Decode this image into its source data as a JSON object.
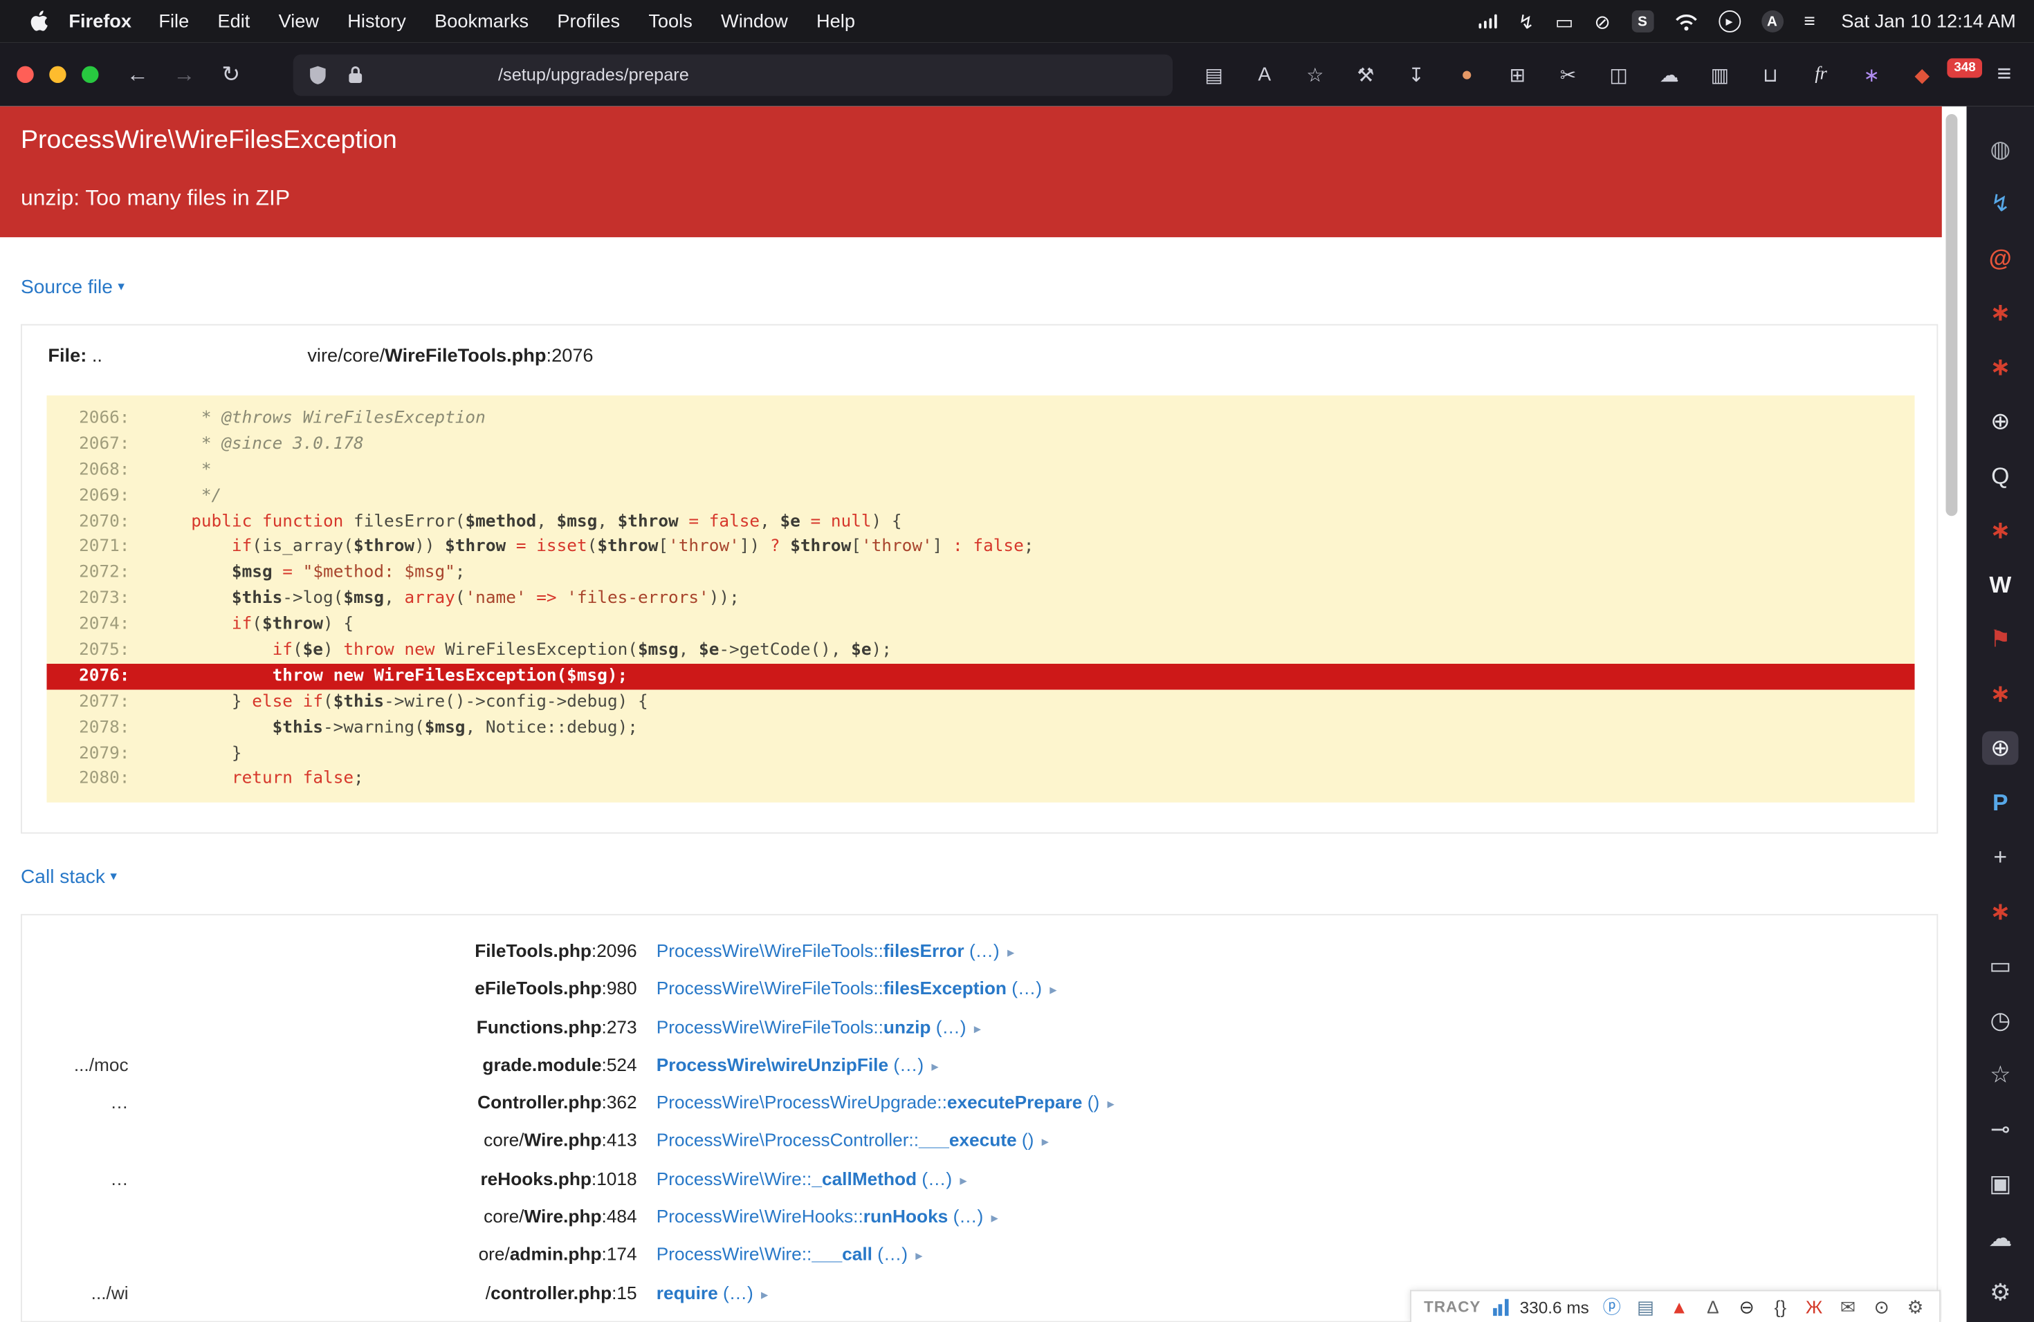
{
  "menubar": {
    "app_name": "Firefox",
    "items": [
      "File",
      "Edit",
      "View",
      "History",
      "Bookmarks",
      "Profiles",
      "Tools",
      "Window",
      "Help"
    ],
    "status_icons": [
      {
        "name": "cellular-signal-icon",
        "type": "bars"
      },
      {
        "name": "power-flash-icon",
        "glyph": "↯"
      },
      {
        "name": "display-mirroring-icon",
        "glyph": "▭"
      },
      {
        "name": "mute-icon",
        "glyph": "⊘"
      },
      {
        "name": "app-badge-s-icon",
        "glyph": "S",
        "chip": "square"
      },
      {
        "name": "wifi-icon",
        "type": "wifi"
      },
      {
        "name": "play-status-icon",
        "glyph": "▶",
        "chip": "ring"
      },
      {
        "name": "app-badge-a-icon",
        "glyph": "A",
        "chip": "circle"
      },
      {
        "name": "menu-list-icon",
        "glyph": "≡"
      }
    ],
    "clock": "Sat Jan 10 12:14 AM"
  },
  "toolbar": {
    "url": "/setup/upgrades/prepare",
    "extension_badge": "348",
    "left_icons": [
      {
        "name": "back-icon",
        "glyph": "←"
      },
      {
        "name": "forward-icon",
        "glyph": "→",
        "dim": true
      },
      {
        "name": "reload-icon",
        "glyph": "↻"
      }
    ],
    "right_icons": [
      {
        "name": "reader-view-icon",
        "glyph": "▤"
      },
      {
        "name": "translate-icon",
        "glyph": "A"
      },
      {
        "name": "bookmark-star-icon",
        "glyph": "☆"
      },
      {
        "name": "tools-wrench-icon",
        "glyph": "⚒"
      },
      {
        "name": "downloads-icon",
        "glyph": "↧"
      },
      {
        "name": "account-avatar-icon",
        "glyph": "●",
        "color": "#e59866"
      },
      {
        "name": "extensions-puzzle-icon",
        "glyph": "⊞"
      },
      {
        "name": "screenshot-icon",
        "glyph": "✂"
      },
      {
        "name": "sidebar-toggle-icon",
        "glyph": "◫"
      },
      {
        "name": "cloud-icon",
        "glyph": "☁"
      },
      {
        "name": "pocket-icon",
        "glyph": "▥"
      },
      {
        "name": "library-icon",
        "glyph": "⊔"
      },
      {
        "name": "fr-extension-icon",
        "glyph": "fr",
        "chip": true
      },
      {
        "name": "extension-flower-icon",
        "glyph": "∗",
        "color": "#b08cf0"
      },
      {
        "name": "adblock-shield-icon",
        "glyph": "◆",
        "color": "#e0543a"
      }
    ],
    "hamburger_glyph": "≡"
  },
  "page": {
    "error_title": "ProcessWire\\WireFilesException",
    "error_message": "unzip: Too many files in ZIP",
    "source_toggle": "Source file",
    "callstack_toggle": "Call stack",
    "file_label": "File:",
    "file_dots": "..",
    "file_dir": "vire/core/",
    "file_name": "WireFileTools.php",
    "file_line": ":2076",
    "caret_down": "▾",
    "link_arrow": "▸",
    "accent_red": "#cd1818",
    "link_blue": "#2878c8",
    "code_bg": "#fdf5ce"
  },
  "source_code": [
    {
      "no": "2066",
      "t": [
        [
          "cm",
          "     * @throws WireFilesException"
        ]
      ]
    },
    {
      "no": "2067",
      "t": [
        [
          "cm",
          "     * @since 3.0.178"
        ]
      ]
    },
    {
      "no": "2068",
      "t": [
        [
          "cm",
          "     *"
        ]
      ]
    },
    {
      "no": "2069",
      "t": [
        [
          "cm",
          "     */"
        ]
      ]
    },
    {
      "no": "2070",
      "t": [
        [
          "pl",
          "    "
        ],
        [
          "kw",
          "public function"
        ],
        [
          "pl",
          " filesError("
        ],
        [
          "vr",
          "$method"
        ],
        [
          "pl",
          ", "
        ],
        [
          "vr",
          "$msg"
        ],
        [
          "pl",
          ", "
        ],
        [
          "vr",
          "$throw"
        ],
        [
          "pl",
          " "
        ],
        [
          "kw",
          "="
        ],
        [
          "pl",
          " "
        ],
        [
          "kw",
          "false"
        ],
        [
          "pl",
          ", "
        ],
        [
          "vr",
          "$e"
        ],
        [
          "pl",
          " "
        ],
        [
          "kw",
          "="
        ],
        [
          "pl",
          " "
        ],
        [
          "kw",
          "null"
        ],
        [
          "pl",
          ") {"
        ]
      ]
    },
    {
      "no": "2071",
      "t": [
        [
          "pl",
          "        "
        ],
        [
          "kw",
          "if"
        ],
        [
          "pl",
          "(is_array("
        ],
        [
          "vr",
          "$throw"
        ],
        [
          "pl",
          ")) "
        ],
        [
          "vr",
          "$throw"
        ],
        [
          "pl",
          " "
        ],
        [
          "kw",
          "="
        ],
        [
          "pl",
          " "
        ],
        [
          "kw",
          "isset"
        ],
        [
          "pl",
          "("
        ],
        [
          "vr",
          "$throw"
        ],
        [
          "pl",
          "["
        ],
        [
          "st",
          "'throw'"
        ],
        [
          "pl",
          "]) "
        ],
        [
          "kw",
          "?"
        ],
        [
          "pl",
          " "
        ],
        [
          "vr",
          "$throw"
        ],
        [
          "pl",
          "["
        ],
        [
          "st",
          "'throw'"
        ],
        [
          "pl",
          "] "
        ],
        [
          "kw",
          ":"
        ],
        [
          "pl",
          " "
        ],
        [
          "kw",
          "false"
        ],
        [
          "pl",
          ";"
        ]
      ]
    },
    {
      "no": "2072",
      "t": [
        [
          "pl",
          "        "
        ],
        [
          "vr",
          "$msg"
        ],
        [
          "pl",
          " "
        ],
        [
          "kw",
          "="
        ],
        [
          "pl",
          " "
        ],
        [
          "st",
          "\"$method: $msg\""
        ],
        [
          "pl",
          ";"
        ]
      ]
    },
    {
      "no": "2073",
      "t": [
        [
          "pl",
          "        "
        ],
        [
          "vr",
          "$this"
        ],
        [
          "pl",
          "->log("
        ],
        [
          "vr",
          "$msg"
        ],
        [
          "pl",
          ", "
        ],
        [
          "kw",
          "array"
        ],
        [
          "pl",
          "("
        ],
        [
          "st",
          "'name'"
        ],
        [
          "pl",
          " "
        ],
        [
          "kw",
          "=>"
        ],
        [
          "pl",
          " "
        ],
        [
          "st",
          "'files-errors'"
        ],
        [
          "pl",
          "));"
        ]
      ]
    },
    {
      "no": "2074",
      "t": [
        [
          "pl",
          "        "
        ],
        [
          "kw",
          "if"
        ],
        [
          "pl",
          "("
        ],
        [
          "vr",
          "$throw"
        ],
        [
          "pl",
          ") {"
        ]
      ]
    },
    {
      "no": "2075",
      "t": [
        [
          "pl",
          "            "
        ],
        [
          "kw",
          "if"
        ],
        [
          "pl",
          "("
        ],
        [
          "vr",
          "$e"
        ],
        [
          "pl",
          ") "
        ],
        [
          "kw",
          "throw new"
        ],
        [
          "pl",
          " WireFilesException("
        ],
        [
          "vr",
          "$msg"
        ],
        [
          "pl",
          ", "
        ],
        [
          "vr",
          "$e"
        ],
        [
          "pl",
          "->getCode(), "
        ],
        [
          "vr",
          "$e"
        ],
        [
          "pl",
          ");"
        ]
      ]
    },
    {
      "no": "2076",
      "hl": true,
      "t": [
        [
          "pl",
          "            throw new WireFilesException($msg);"
        ]
      ]
    },
    {
      "no": "2077",
      "t": [
        [
          "pl",
          "        } "
        ],
        [
          "kw",
          "else if"
        ],
        [
          "pl",
          "("
        ],
        [
          "vr",
          "$this"
        ],
        [
          "pl",
          "->wire()->config->debug) {"
        ]
      ]
    },
    {
      "no": "2078",
      "t": [
        [
          "pl",
          "            "
        ],
        [
          "vr",
          "$this"
        ],
        [
          "pl",
          "->warning("
        ],
        [
          "vr",
          "$msg"
        ],
        [
          "pl",
          ", Notice::debug);"
        ]
      ]
    },
    {
      "no": "2079",
      "t": [
        [
          "pl",
          "        }"
        ]
      ]
    },
    {
      "no": "2080",
      "t": [
        [
          "pl",
          "        "
        ],
        [
          "kw",
          "return"
        ],
        [
          "pl",
          " "
        ],
        [
          "kw",
          "false"
        ],
        [
          "pl",
          ";"
        ]
      ]
    }
  ],
  "callstack": [
    {
      "left": "",
      "pre": "",
      "file": "FileTools.php",
      "line": ":2096",
      "ns": "ProcessWire\\WireFileTools::",
      "fn": "filesError",
      "args": " (…)"
    },
    {
      "left": "",
      "pre": "",
      "file": "eFileTools.php",
      "line": ":980",
      "ns": "ProcessWire\\WireFileTools::",
      "fn": "filesException",
      "args": " (…)"
    },
    {
      "left": "",
      "pre": "",
      "file": "Functions.php",
      "line": ":273",
      "ns": "ProcessWire\\WireFileTools::",
      "fn": "unzip",
      "args": " (…)"
    },
    {
      "left": ".../moc",
      "pre": "",
      "file": "grade.module",
      "line": ":524",
      "ns": "",
      "fn": "ProcessWire\\wireUnzipFile",
      "args": " (…)"
    },
    {
      "left": "…",
      "pre": "",
      "file": "Controller.php",
      "line": ":362",
      "ns": "ProcessWire\\ProcessWireUpgrade::",
      "fn": "executePrepare",
      "args": " ()"
    },
    {
      "left": "",
      "pre": "core/",
      "file": "Wire.php",
      "line": ":413",
      "ns": "ProcessWire\\ProcessController::",
      "fn": "___execute",
      "args": " ()"
    },
    {
      "left": "…",
      "pre": "",
      "file": "reHooks.php",
      "line": ":1018",
      "ns": "ProcessWire\\Wire::",
      "fn": "_callMethod",
      "args": " (…)"
    },
    {
      "left": "",
      "pre": "core/",
      "file": "Wire.php",
      "line": ":484",
      "ns": "ProcessWire\\WireHooks::",
      "fn": "runHooks",
      "args": " (…)"
    },
    {
      "left": "",
      "pre": "ore/",
      "file": "admin.php",
      "line": ":174",
      "ns": "ProcessWire\\Wire::",
      "fn": "___call",
      "args": " (…)"
    },
    {
      "left": ".../wi",
      "pre": "/",
      "file": "controller.php",
      "line": ":15",
      "ns": "",
      "fn": "require",
      "args": " (…)"
    }
  ],
  "tracy": {
    "logo": "TRACY",
    "time": "330.6 ms",
    "icons": [
      {
        "name": "tracy-info-icon",
        "glyph": "ⓟ",
        "color": "#3a85d0"
      },
      {
        "name": "tracy-dumps-icon",
        "glyph": "▤",
        "color": "#5a7d9a"
      },
      {
        "name": "tracy-rocket-icon",
        "glyph": "▲",
        "color": "#e23c2e"
      },
      {
        "name": "tracy-bell-icon",
        "glyph": "∆",
        "color": "#555555"
      },
      {
        "name": "tracy-ban-icon",
        "glyph": "⊖",
        "color": "#333333"
      },
      {
        "name": "tracy-braces-icon",
        "glyph": "{}",
        "color": "#444444"
      },
      {
        "name": "tracy-bug-icon",
        "glyph": "Ж",
        "color": "#d43a2a"
      },
      {
        "name": "tracy-mail-icon",
        "glyph": "✉",
        "color": "#555555"
      },
      {
        "name": "tracy-power-icon",
        "glyph": "⊙",
        "color": "#444444"
      },
      {
        "name": "tracy-gear-icon",
        "glyph": "⚙",
        "color": "#555555"
      }
    ]
  },
  "sidebar_icons": [
    {
      "name": "tab-favicon-sphere",
      "glyph": "◍",
      "color": "#a9adb4"
    },
    {
      "name": "tab-favicon-flash",
      "glyph": "↯",
      "color": "#57a8e8"
    },
    {
      "name": "tab-favicon-swirl",
      "glyph": "@",
      "color": "#e8553a",
      "bold": true
    },
    {
      "name": "tab-favicon-asterisk-1",
      "glyph": "∗",
      "color": "#d6402e",
      "bold": true
    },
    {
      "name": "tab-favicon-asterisk-2",
      "glyph": "∗",
      "color": "#d6402e",
      "bold": true
    },
    {
      "name": "tab-favicon-globe-1",
      "glyph": "⊕",
      "color": "#e4e6ea"
    },
    {
      "name": "tab-favicon-circle",
      "glyph": "Q",
      "color": "#dfe2e6"
    },
    {
      "name": "tab-favicon-asterisk-3",
      "glyph": "∗",
      "color": "#d6402e",
      "bold": true
    },
    {
      "name": "tab-favicon-wikipedia",
      "glyph": "W",
      "color": "#f2f2f4",
      "bold": true
    },
    {
      "name": "tab-favicon-flag",
      "glyph": "⚑",
      "color": "#cc3b34"
    },
    {
      "name": "tab-favicon-asterisk-4",
      "glyph": "∗",
      "color": "#d6402e",
      "bold": true
    },
    {
      "name": "tab-favicon-globe-active",
      "glyph": "⊕",
      "color": "#eef0f4",
      "active": true
    },
    {
      "name": "tab-favicon-processwire",
      "glyph": "P",
      "color": "#57a8e8",
      "bold": true
    },
    {
      "name": "sidebar-new-tab-icon",
      "glyph": "+",
      "color": "#cfd2d8"
    },
    {
      "name": "tab-favicon-asterisk-5",
      "glyph": "∗",
      "color": "#d6402e",
      "bold": true
    },
    {
      "name": "sidebar-screen-icon",
      "glyph": "▭",
      "color": "#cfd2d8"
    },
    {
      "name": "sidebar-history-icon",
      "glyph": "◷",
      "color": "#cfd2d8"
    },
    {
      "name": "sidebar-bookmarks-icon",
      "glyph": "☆",
      "color": "#cfd2d8"
    },
    {
      "name": "sidebar-passwords-icon",
      "glyph": "⊸",
      "color": "#cfd2d8"
    },
    {
      "name": "sidebar-devices-icon",
      "glyph": "▣",
      "color": "#cfd2d8"
    },
    {
      "name": "sidebar-sync-cloud-icon",
      "glyph": "☁",
      "color": "#cfd2d8"
    },
    {
      "name": "sidebar-settings-icon",
      "glyph": "⚙",
      "color": "#cfd2d8"
    }
  ]
}
